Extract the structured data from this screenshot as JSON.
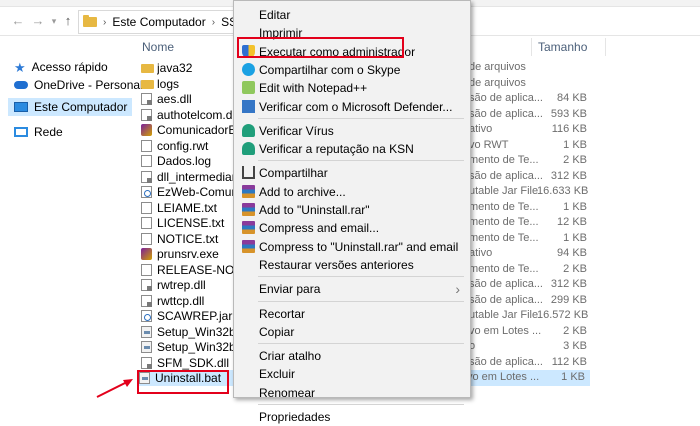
{
  "breadcrumb": {
    "root": "Este Computador",
    "current": "SSD Isa (C"
  },
  "columns": {
    "name": "Nome",
    "size": "Tamanho"
  },
  "nav": [
    {
      "label": "Acesso rápido",
      "icon": "star-icon"
    },
    {
      "label": "OneDrive - Personal",
      "icon": "cloud-icon"
    },
    {
      "label": "Este Computador",
      "icon": "computer-icon",
      "selected": true
    },
    {
      "label": "Rede",
      "icon": "network-icon"
    }
  ],
  "files": [
    {
      "name": "java32",
      "type": "de arquivos",
      "size": "",
      "icon": "folder"
    },
    {
      "name": "logs",
      "type": "de arquivos",
      "size": "",
      "icon": "folder"
    },
    {
      "name": "aes.dll",
      "type": "são de aplica...",
      "size": "84 KB",
      "icon": "dll"
    },
    {
      "name": "authotelcom.dll",
      "type": "são de aplica...",
      "size": "593 KB",
      "icon": "dll"
    },
    {
      "name": "ComunicadorEzWe",
      "type": "ativo",
      "size": "116 KB",
      "icon": "exe"
    },
    {
      "name": "config.rwt",
      "type": "vo RWT",
      "size": "1 KB",
      "icon": "doc"
    },
    {
      "name": "Dados.log",
      "type": "mento de Te...",
      "size": "2 KB",
      "icon": "doc"
    },
    {
      "name": "dll_intermediaria.dl",
      "type": "são de aplica...",
      "size": "312 KB",
      "icon": "dll"
    },
    {
      "name": "EzWeb-Comunicad",
      "type": "utable Jar File",
      "size": "16.633 KB",
      "icon": "jar"
    },
    {
      "name": "LEIAME.txt",
      "type": "mento de Te...",
      "size": "1 KB",
      "icon": "doc"
    },
    {
      "name": "LICENSE.txt",
      "type": "mento de Te...",
      "size": "12 KB",
      "icon": "doc"
    },
    {
      "name": "NOTICE.txt",
      "type": "mento de Te...",
      "size": "1 KB",
      "icon": "doc"
    },
    {
      "name": "prunsrv.exe",
      "type": "ativo",
      "size": "94 KB",
      "icon": "exe"
    },
    {
      "name": "RELEASE-NOTES.txt",
      "type": "mento de Te...",
      "size": "2 KB",
      "icon": "doc"
    },
    {
      "name": "rwtrep.dll",
      "type": "são de aplica...",
      "size": "312 KB",
      "icon": "dll"
    },
    {
      "name": "rwttcp.dll",
      "type": "são de aplica...",
      "size": "299 KB",
      "icon": "dll"
    },
    {
      "name": "SCAWREP.jar",
      "type": "utable Jar File",
      "size": "16.572 KB",
      "icon": "jar"
    },
    {
      "name": "Setup_Win32bit.bat",
      "type": "vo em Lotes ...",
      "size": "2 KB",
      "icon": "bat"
    },
    {
      "name": "Setup_Win32bit",
      "type": "o",
      "size": "3 KB",
      "icon": "bat"
    },
    {
      "name": "SFM_SDK.dll",
      "type": "são de aplica...",
      "size": "112 KB",
      "icon": "dll"
    },
    {
      "name": "Uninstall.bat",
      "type": "vo em Lotes ...",
      "size": "1 KB",
      "icon": "bat",
      "selected": true
    }
  ],
  "context_menu": [
    {
      "label": "Editar",
      "icon": ""
    },
    {
      "label": "Imprimir",
      "icon": ""
    },
    {
      "label": "Executar como administrador",
      "icon": "shield-icon",
      "highlighted": true
    },
    {
      "label": "Compartilhar com o Skype",
      "icon": "skype-icon"
    },
    {
      "label": "Edit with Notepad++",
      "icon": "notepad-plus-plus-icon"
    },
    {
      "label": "Verificar com o Microsoft Defender...",
      "icon": "defender-icon"
    },
    {
      "sep": true
    },
    {
      "label": "Verificar Vírus",
      "icon": "kaspersky-icon"
    },
    {
      "label": "Verificar a reputação na KSN",
      "icon": "kaspersky-icon"
    },
    {
      "sep": true
    },
    {
      "label": "Compartilhar",
      "icon": "share-icon"
    },
    {
      "label": "Add to archive...",
      "icon": "winrar-icon"
    },
    {
      "label": "Add to \"Uninstall.rar\"",
      "icon": "winrar-icon"
    },
    {
      "label": "Compress and email...",
      "icon": "winrar-icon"
    },
    {
      "label": "Compress to \"Uninstall.rar\" and email",
      "icon": "winrar-icon"
    },
    {
      "label": "Restaurar versões anteriores",
      "icon": ""
    },
    {
      "sep": true
    },
    {
      "label": "Enviar para",
      "icon": "",
      "submenu": true
    },
    {
      "sep": true
    },
    {
      "label": "Recortar",
      "icon": ""
    },
    {
      "label": "Copiar",
      "icon": ""
    },
    {
      "sep": true
    },
    {
      "label": "Criar atalho",
      "icon": ""
    },
    {
      "label": "Excluir",
      "icon": ""
    },
    {
      "label": "Renomear",
      "icon": ""
    },
    {
      "sep": true
    },
    {
      "label": "Propriedades",
      "icon": ""
    }
  ],
  "colors": {
    "highlight_red": "#e3001b",
    "selection": "#cce8ff"
  }
}
